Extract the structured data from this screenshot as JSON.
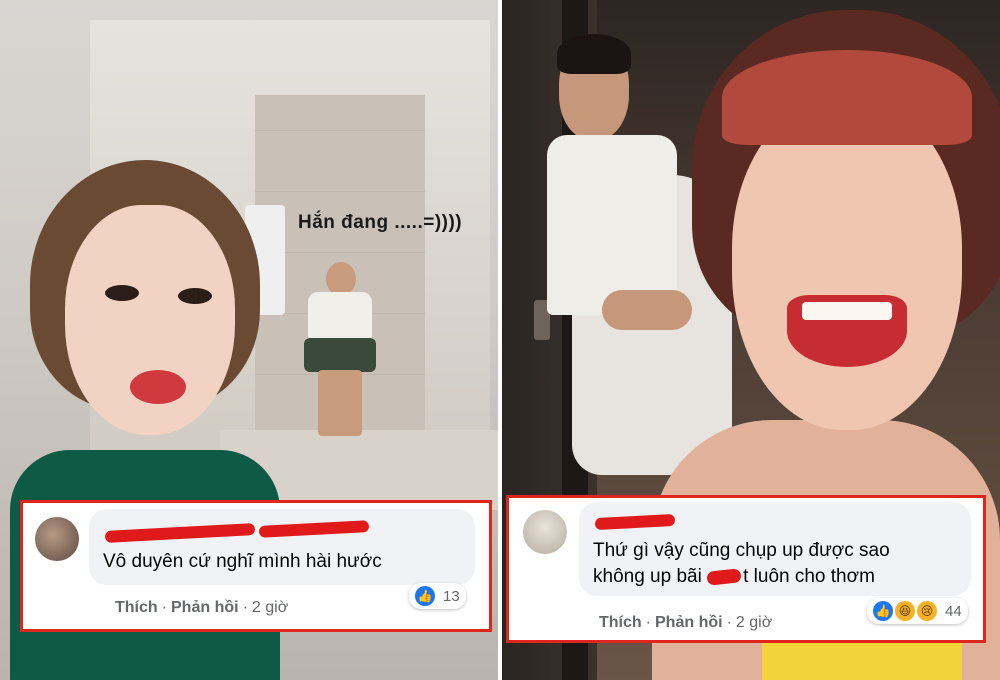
{
  "left_photo": {
    "caption": "Hắn đang .....=))))",
    "comment": {
      "text": "Vô duyên cứ nghĩ mình hài hước",
      "actions": {
        "like": "Thích",
        "reply": "Phản hồi",
        "time": "2 giờ"
      },
      "reactions": {
        "icons": [
          "like-icon"
        ],
        "count": "13"
      }
    }
  },
  "right_photo": {
    "comment": {
      "line1": "Thứ gì vậy cũng chụp up được sao",
      "line2_prefix": "không up bãi",
      "line2_suffix": "t luôn cho thơm",
      "actions": {
        "like": "Thích",
        "reply": "Phản hồi",
        "time": "2 giờ"
      },
      "reactions": {
        "icons": [
          "like-icon",
          "haha-icon",
          "sad-icon"
        ],
        "count": "44"
      }
    }
  },
  "colors": {
    "highlight_border": "#e0261c",
    "redaction": "#e01a1a",
    "like_blue": "#1877f2",
    "comment_bubble": "#f0f2f5",
    "meta_text": "#65676b"
  }
}
